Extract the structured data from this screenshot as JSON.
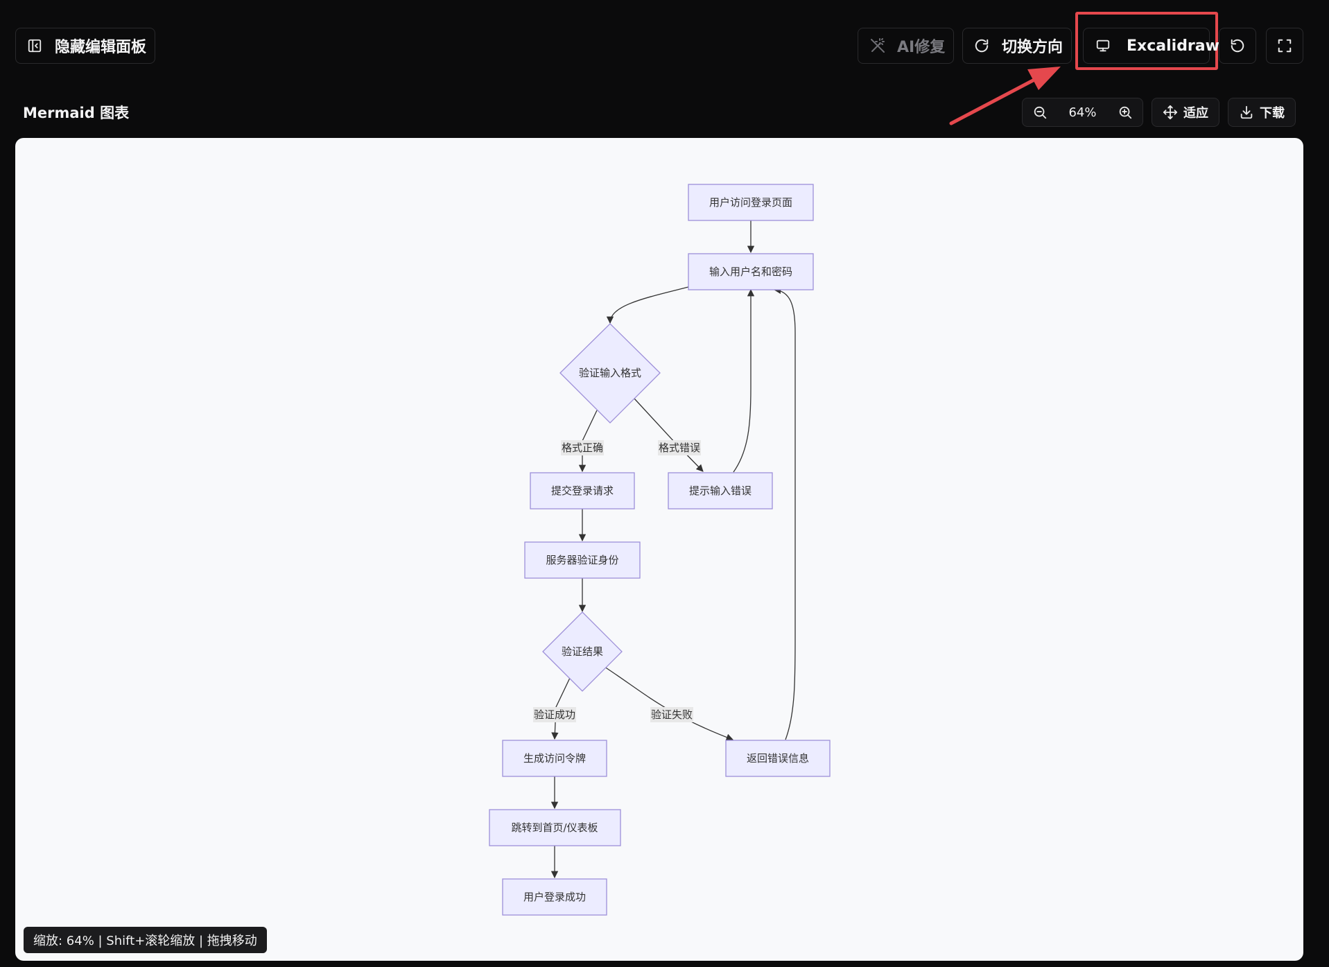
{
  "toolbar": {
    "toggle_panel_label": "隐藏编辑面板",
    "ai_fix_label": "AI修复",
    "switch_direction_label": "切换方向",
    "excalidraw_label": "Excalidraw"
  },
  "panel": {
    "title": "Mermaid 图表",
    "zoom_value": "64%",
    "fit_label": "适应",
    "download_label": "下载"
  },
  "colors": {
    "page_bg": "#0b0b0c",
    "canvas_bg": "#f8f9fb",
    "node_fill": "#ececff",
    "node_stroke": "#9d8fd9",
    "highlight": "#e5484d"
  },
  "diagram": {
    "nodes": {
      "n1": "用户访问登录页面",
      "n2": "输入用户名和密码",
      "n3": "验证输入格式",
      "n4": "提交登录请求",
      "n5": "提示输入错误",
      "n6": "服务器验证身份",
      "n7": "验证结果",
      "n8": "生成访问令牌",
      "n9": "返回错误信息",
      "n10": "跳转到首页/仪表板",
      "n11": "用户登录成功"
    },
    "edge_labels": {
      "format_ok": "格式正确",
      "format_err": "格式错误",
      "verify_ok": "验证成功",
      "verify_fail": "验证失败"
    }
  },
  "status": {
    "text": "缩放: 64% | Shift+滚轮缩放 | 拖拽移动"
  }
}
